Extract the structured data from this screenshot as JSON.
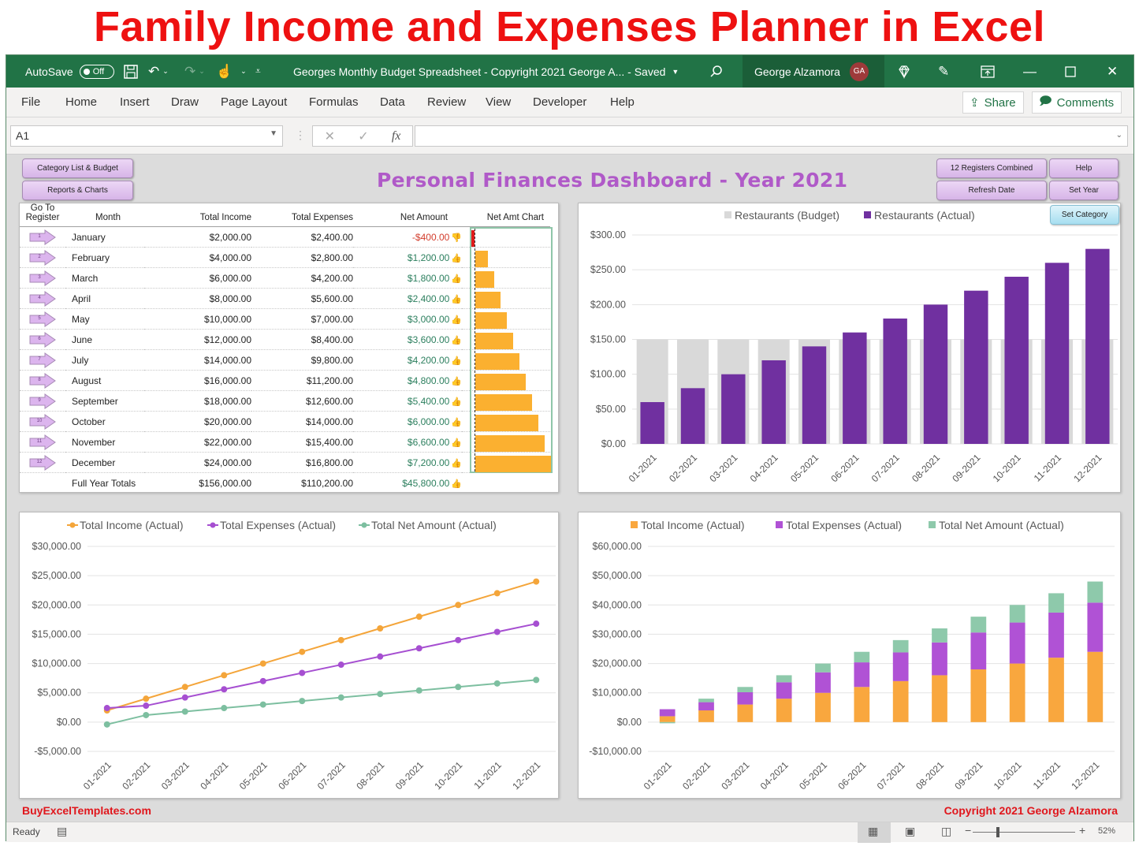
{
  "banner": {
    "title": "Family Income and Expenses Planner in Excel"
  },
  "titlebar": {
    "autosave_label": "AutoSave",
    "autosave_state": "Off",
    "doc_title": "Georges Monthly Budget Spreadsheet - Copyright 2021 George A...  -  Saved",
    "user_name": "George Alzamora",
    "user_initials": "GA",
    "icons": [
      "save-icon",
      "undo-icon",
      "redo-icon",
      "touch-mode-icon",
      "customize-qat-icon",
      "search-icon",
      "diamond-icon",
      "pen-icon",
      "ribbon-display-icon",
      "minimize-icon",
      "maximize-icon",
      "close-icon"
    ]
  },
  "menu": {
    "items": [
      "File",
      "Home",
      "Insert",
      "Draw",
      "Page Layout",
      "Formulas",
      "Data",
      "Review",
      "View",
      "Developer",
      "Help"
    ],
    "share_label": "Share",
    "comments_label": "Comments"
  },
  "formula_bar": {
    "name_box": "A1",
    "formula": ""
  },
  "dashboard": {
    "title": "Personal Finances Dashboard - Year 2021",
    "buttons_left": [
      "Category List & Budget",
      "Reports & Charts"
    ],
    "buttons_right": [
      "12 Registers Combined",
      "Help",
      "Refresh Date",
      "Set Year"
    ],
    "set_category_label": "Set Category"
  },
  "table": {
    "headers": [
      "Go To Register",
      "Month",
      "Total Income",
      "Total Expenses",
      "Net Amount",
      "Net Amt Chart"
    ],
    "rows": [
      {
        "reg": "1",
        "month": "January",
        "income": "$2,000.00",
        "expenses": "$2,400.00",
        "net": "-$400.00",
        "net_value": -400,
        "trend": "down"
      },
      {
        "reg": "2",
        "month": "February",
        "income": "$4,000.00",
        "expenses": "$2,800.00",
        "net": "$1,200.00",
        "net_value": 1200,
        "trend": "up"
      },
      {
        "reg": "3",
        "month": "March",
        "income": "$6,000.00",
        "expenses": "$4,200.00",
        "net": "$1,800.00",
        "net_value": 1800,
        "trend": "up"
      },
      {
        "reg": "4",
        "month": "April",
        "income": "$8,000.00",
        "expenses": "$5,600.00",
        "net": "$2,400.00",
        "net_value": 2400,
        "trend": "up"
      },
      {
        "reg": "5",
        "month": "May",
        "income": "$10,000.00",
        "expenses": "$7,000.00",
        "net": "$3,000.00",
        "net_value": 3000,
        "trend": "up"
      },
      {
        "reg": "6",
        "month": "June",
        "income": "$12,000.00",
        "expenses": "$8,400.00",
        "net": "$3,600.00",
        "net_value": 3600,
        "trend": "up"
      },
      {
        "reg": "7",
        "month": "July",
        "income": "$14,000.00",
        "expenses": "$9,800.00",
        "net": "$4,200.00",
        "net_value": 4200,
        "trend": "up"
      },
      {
        "reg": "8",
        "month": "August",
        "income": "$16,000.00",
        "expenses": "$11,200.00",
        "net": "$4,800.00",
        "net_value": 4800,
        "trend": "up"
      },
      {
        "reg": "9",
        "month": "September",
        "income": "$18,000.00",
        "expenses": "$12,600.00",
        "net": "$5,400.00",
        "net_value": 5400,
        "trend": "up"
      },
      {
        "reg": "10",
        "month": "October",
        "income": "$20,000.00",
        "expenses": "$14,000.00",
        "net": "$6,000.00",
        "net_value": 6000,
        "trend": "up"
      },
      {
        "reg": "11",
        "month": "November",
        "income": "$22,000.00",
        "expenses": "$15,400.00",
        "net": "$6,600.00",
        "net_value": 6600,
        "trend": "up"
      },
      {
        "reg": "12",
        "month": "December",
        "income": "$24,000.00",
        "expenses": "$16,800.00",
        "net": "$7,200.00",
        "net_value": 7200,
        "trend": "up"
      }
    ],
    "totals": {
      "label": "Full Year Totals",
      "income": "$156,000.00",
      "expenses": "$110,200.00",
      "net": "$45,800.00",
      "trend": "up"
    },
    "colors": {
      "positive_bar": "#fbb030",
      "negative_bar": "#e01b1b"
    }
  },
  "chart_data": [
    {
      "id": "restaurants",
      "type": "bar",
      "title": "",
      "categories": [
        "01-2021",
        "02-2021",
        "03-2021",
        "04-2021",
        "05-2021",
        "06-2021",
        "07-2021",
        "08-2021",
        "09-2021",
        "10-2021",
        "11-2021",
        "12-2021"
      ],
      "series": [
        {
          "name": "Restaurants (Budget)",
          "color": "#d9d9d9",
          "values": [
            150,
            150,
            150,
            150,
            150,
            150,
            150,
            150,
            150,
            150,
            150,
            150
          ]
        },
        {
          "name": "Restaurants (Actual)",
          "color": "#7030a0",
          "values": [
            60,
            80,
            100,
            120,
            140,
            160,
            180,
            200,
            220,
            240,
            260,
            280
          ]
        }
      ],
      "yticks": [
        "$0.00",
        "$50.00",
        "$100.00",
        "$150.00",
        "$200.00",
        "$250.00",
        "$300.00"
      ],
      "ylim": [
        0,
        300
      ],
      "grid": true,
      "legend": "top"
    },
    {
      "id": "totals-line",
      "type": "line",
      "title": "",
      "categories": [
        "01-2021",
        "02-2021",
        "03-2021",
        "04-2021",
        "05-2021",
        "06-2021",
        "07-2021",
        "08-2021",
        "09-2021",
        "10-2021",
        "11-2021",
        "12-2021"
      ],
      "series": [
        {
          "name": "Total Income (Actual)",
          "color": "#f4a53a",
          "values": [
            2000,
            4000,
            6000,
            8000,
            10000,
            12000,
            14000,
            16000,
            18000,
            20000,
            22000,
            24000
          ]
        },
        {
          "name": "Total Expenses (Actual)",
          "color": "#a64fd1",
          "values": [
            2400,
            2800,
            4200,
            5600,
            7000,
            8400,
            9800,
            11200,
            12600,
            14000,
            15400,
            16800
          ]
        },
        {
          "name": "Total Net Amount (Actual)",
          "color": "#7dbfa0",
          "values": [
            -400,
            1200,
            1800,
            2400,
            3000,
            3600,
            4200,
            4800,
            5400,
            6000,
            6600,
            7200
          ]
        }
      ],
      "yticks": [
        "-$5,000.00",
        "$0.00",
        "$5,000.00",
        "$10,000.00",
        "$15,000.00",
        "$20,000.00",
        "$25,000.00",
        "$30,000.00"
      ],
      "ylim": [
        -5000,
        30000
      ],
      "grid": true,
      "legend": "top"
    },
    {
      "id": "totals-stacked",
      "type": "bar",
      "stacked": true,
      "title": "",
      "categories": [
        "01-2021",
        "02-2021",
        "03-2021",
        "04-2021",
        "05-2021",
        "06-2021",
        "07-2021",
        "08-2021",
        "09-2021",
        "10-2021",
        "11-2021",
        "12-2021"
      ],
      "series": [
        {
          "name": "Total Income (Actual)",
          "color": "#f9a73e",
          "values": [
            2000,
            4000,
            6000,
            8000,
            10000,
            12000,
            14000,
            16000,
            18000,
            20000,
            22000,
            24000
          ]
        },
        {
          "name": "Total Expenses (Actual)",
          "color": "#b052d5",
          "values": [
            2400,
            2800,
            4200,
            5600,
            7000,
            8400,
            9800,
            11200,
            12600,
            14000,
            15400,
            16800
          ]
        },
        {
          "name": "Total Net Amount (Actual)",
          "color": "#8ec9ab",
          "values": [
            -400,
            1200,
            1800,
            2400,
            3000,
            3600,
            4200,
            4800,
            5400,
            6000,
            6600,
            7200
          ]
        }
      ],
      "yticks": [
        "-$10,000.00",
        "$0.00",
        "$10,000.00",
        "$20,000.00",
        "$30,000.00",
        "$40,000.00",
        "$50,000.00",
        "$60,000.00"
      ],
      "ylim": [
        -10000,
        60000
      ],
      "grid": true,
      "legend": "top"
    }
  ],
  "footer": {
    "left": "BuyExcelTemplates.com",
    "right": "Copyright 2021  George Alzamora"
  },
  "statusbar": {
    "status": "Ready",
    "zoom": "52%",
    "zoom_fraction": 0.52
  }
}
